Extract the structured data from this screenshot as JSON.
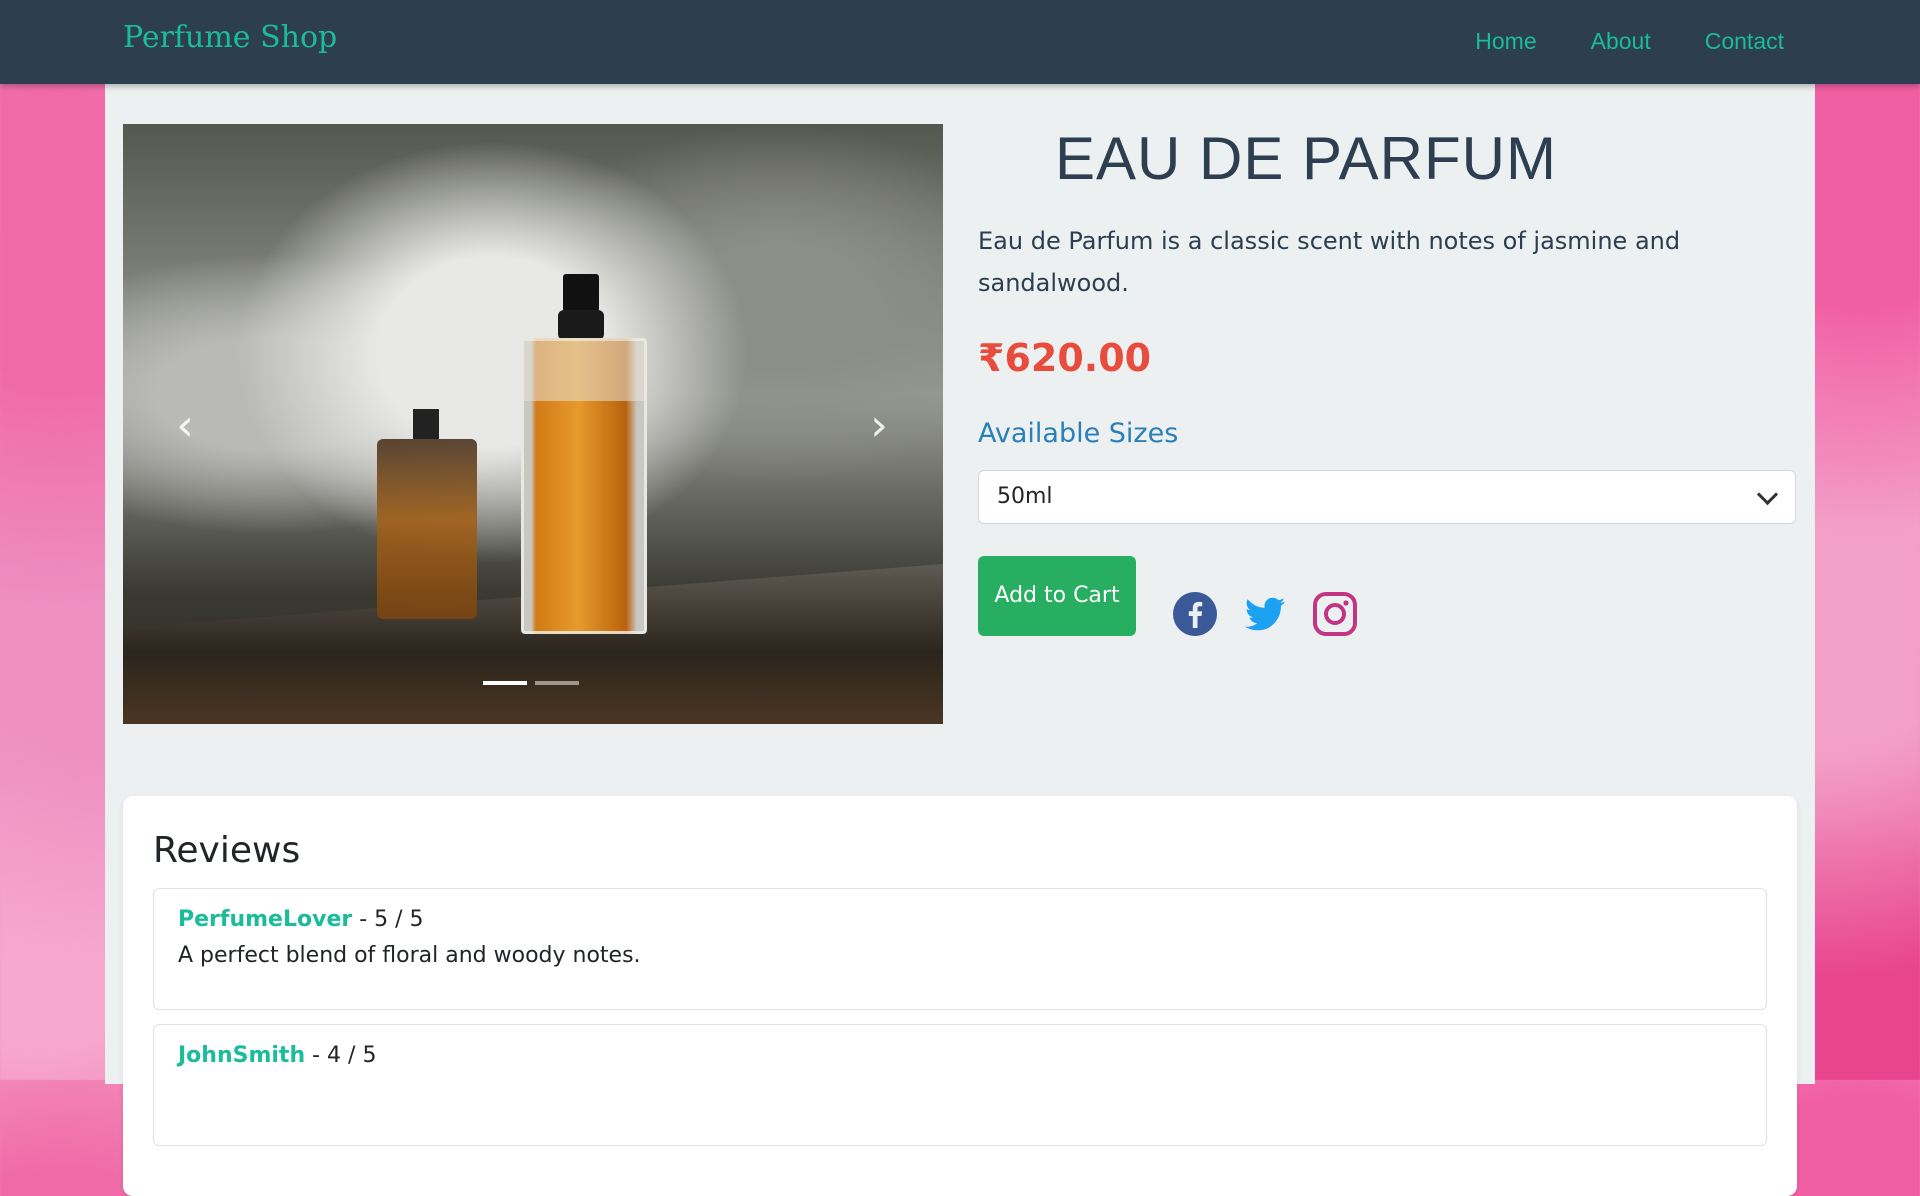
{
  "navbar": {
    "brand": "Perfume Shop",
    "links": [
      "Home",
      "About",
      "Contact"
    ]
  },
  "product": {
    "title": "EAU DE PARFUM",
    "description": "Eau de Parfum is a classic scent with notes of jasmine and sandalwood.",
    "price": "₹620.00",
    "sizes_label": "Available Sizes",
    "selected_size": "50ml",
    "add_to_cart_label": "Add to Cart"
  },
  "carousel": {
    "slides": 2,
    "active_slide": 1,
    "prev_icon": "chevron-left-icon",
    "next_icon": "chevron-right-icon"
  },
  "social": {
    "icons": [
      "facebook-icon",
      "twitter-icon",
      "instagram-icon"
    ],
    "colors": {
      "facebook": "#3b5998",
      "twitter": "#1da1f2",
      "instagram": "#c13584"
    }
  },
  "reviews": {
    "title": "Reviews",
    "items": [
      {
        "name": "PerfumeLover",
        "rating": "- 5 / 5",
        "text": "A perfect blend of floral and woody notes."
      },
      {
        "name": "JohnSmith",
        "rating": "- 4 / 5",
        "text": ""
      }
    ]
  },
  "colors": {
    "navbar": "#2c3e50",
    "accent": "#1abc9c",
    "price": "#e74c3c",
    "sizes_label": "#2980b9",
    "cart_button": "#27ae60"
  }
}
